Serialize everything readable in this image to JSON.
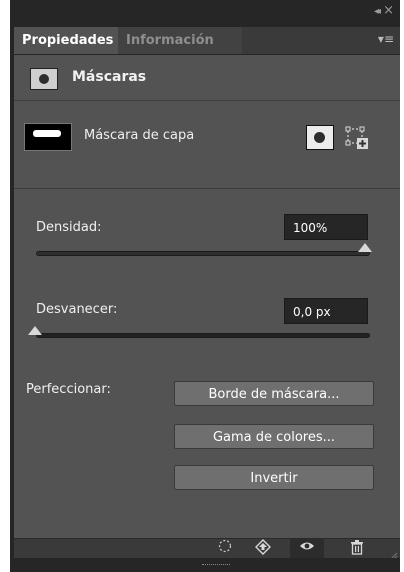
{
  "window": {
    "collapse_glyph": "◂◂",
    "close_glyph": "×"
  },
  "tabs": [
    {
      "label": "Propiedades",
      "active": true
    },
    {
      "label": "Información",
      "active": false
    }
  ],
  "panel_menu_glyph": "▾≡",
  "section": {
    "title": "Máscaras",
    "icon": "layer-mask-icon"
  },
  "layer": {
    "label": "Máscara de capa",
    "pixel_mask_icon": "pixel-mask-icon",
    "vector_mask_icon": "vector-mask-icon"
  },
  "density": {
    "label": "Densidad:",
    "value": "100%",
    "fraction": 1.0
  },
  "feather": {
    "label": "Desvanecer:",
    "value": "0,0 px",
    "fraction": 0.0
  },
  "refine": {
    "label": "Perfeccionar:",
    "buttons": [
      "Borde de máscara...",
      "Gama de colores...",
      "Invertir"
    ]
  },
  "footer_icons": [
    "load-selection-icon",
    "apply-mask-icon",
    "toggle-visibility-icon",
    "delete-mask-icon"
  ],
  "colors": {
    "panel_bg": "#535353",
    "frame_bg": "#262626",
    "field_bg": "#262626",
    "button_bg": "#6f6f6f"
  }
}
